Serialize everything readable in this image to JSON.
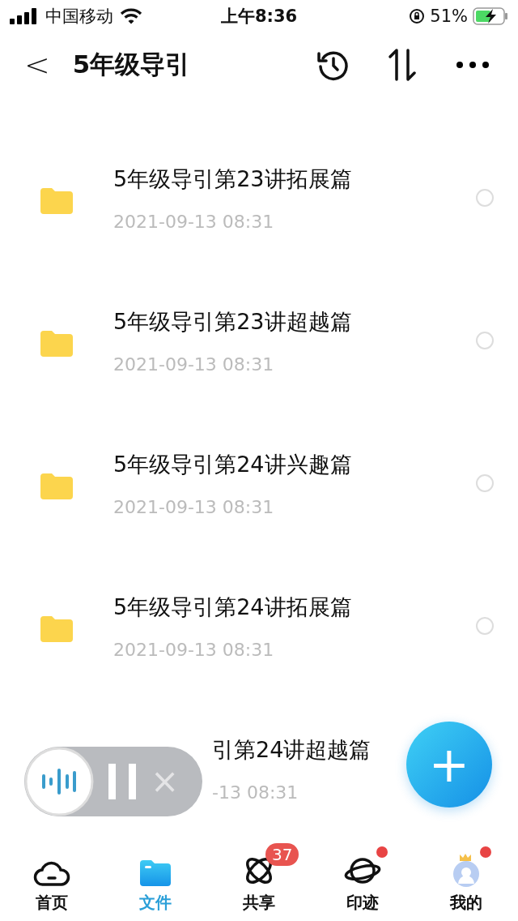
{
  "status_bar": {
    "carrier": "中国移动",
    "time": "上午8:36",
    "battery": "51%"
  },
  "header": {
    "back": "<",
    "title": "5年级导引"
  },
  "files": [
    {
      "title": "5年级导引第23讲拓展篇",
      "date": "2021-09-13 08:31",
      "checked": false
    },
    {
      "title": "5年级导引第23讲超越篇",
      "date": "2021-09-13 08:31",
      "checked": false
    },
    {
      "title": "5年级导引第24讲兴趣篇",
      "date": "2021-09-13 08:31",
      "checked": false
    },
    {
      "title": "5年级导引第24讲拓展篇",
      "date": "2021-09-13 08:31",
      "checked": false
    },
    {
      "title": "引第24讲超越篇",
      "date": "-13 08:31",
      "partial": true
    }
  ],
  "audio_widget": {
    "close": "×"
  },
  "fab": {
    "label": "+"
  },
  "nav": [
    {
      "label": "首页",
      "kind": "cloud",
      "selected": false
    },
    {
      "label": "文件",
      "kind": "folder",
      "selected": true
    },
    {
      "label": "共享",
      "kind": "atom",
      "selected": false,
      "badge": "37"
    },
    {
      "label": "印迹",
      "kind": "planet",
      "selected": false,
      "dot": true
    },
    {
      "label": "我的",
      "kind": "avatar",
      "selected": false,
      "dot": true
    }
  ]
}
